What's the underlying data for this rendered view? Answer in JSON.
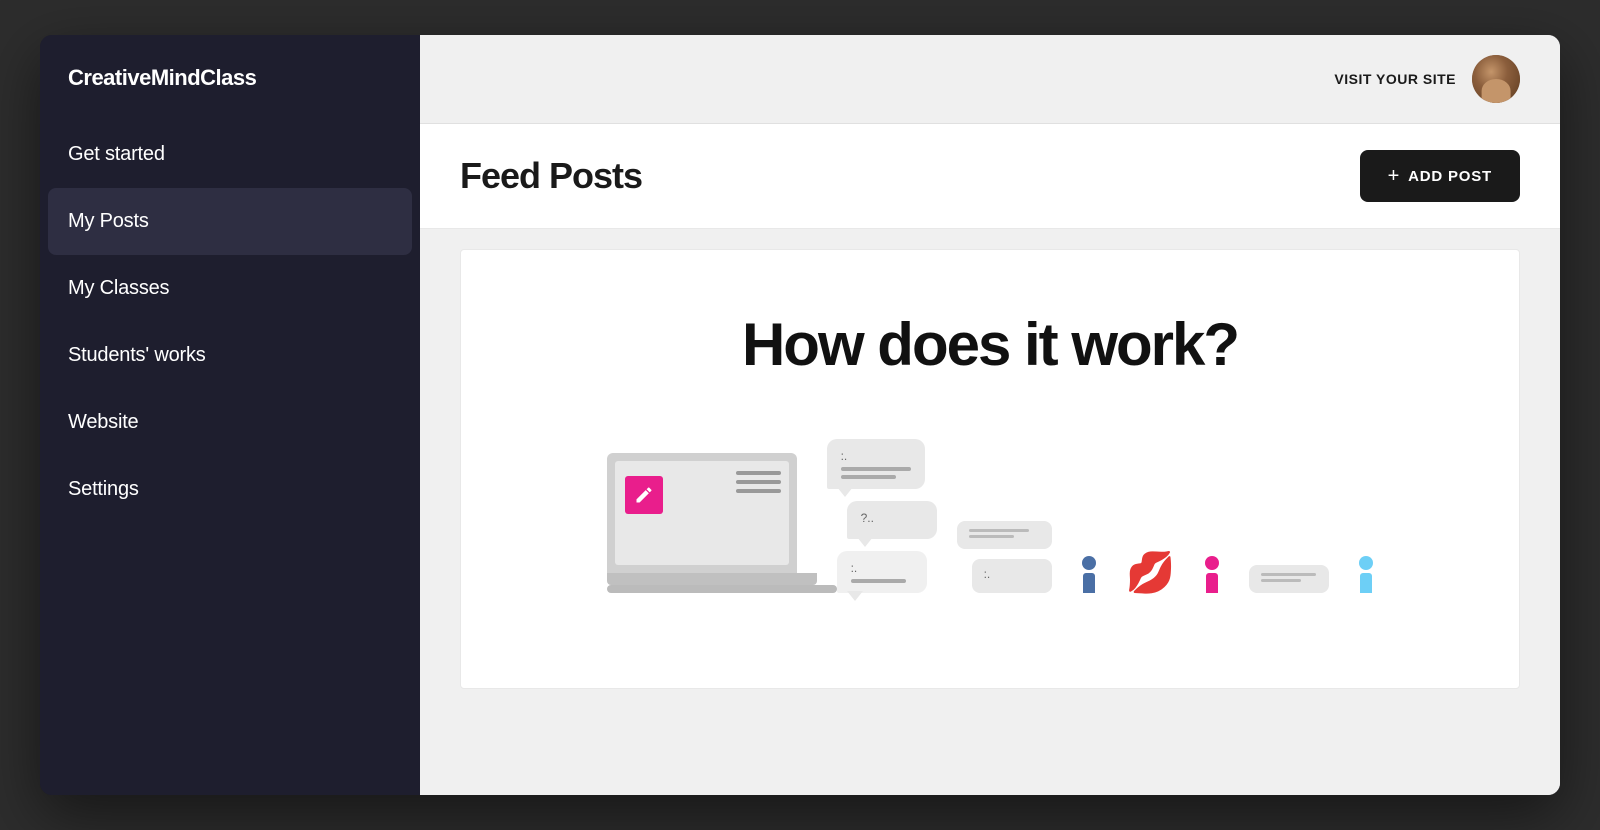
{
  "app": {
    "name": "CreativeMindClass"
  },
  "sidebar": {
    "logo": "CreativeMindClass",
    "items": [
      {
        "id": "get-started",
        "label": "Get started",
        "active": false
      },
      {
        "id": "my-posts",
        "label": "My Posts",
        "active": true
      },
      {
        "id": "my-classes",
        "label": "My Classes",
        "active": false
      },
      {
        "id": "students-works",
        "label": "Students' works",
        "active": false
      },
      {
        "id": "website",
        "label": "Website",
        "active": false
      },
      {
        "id": "settings",
        "label": "Settings",
        "active": false
      }
    ]
  },
  "header": {
    "visit_site_label": "VISIT YOUR SITE"
  },
  "page": {
    "title": "Feed Posts",
    "add_post_label": "ADD POST",
    "add_post_icon": "+"
  },
  "content": {
    "card_title": "How does it work?"
  }
}
